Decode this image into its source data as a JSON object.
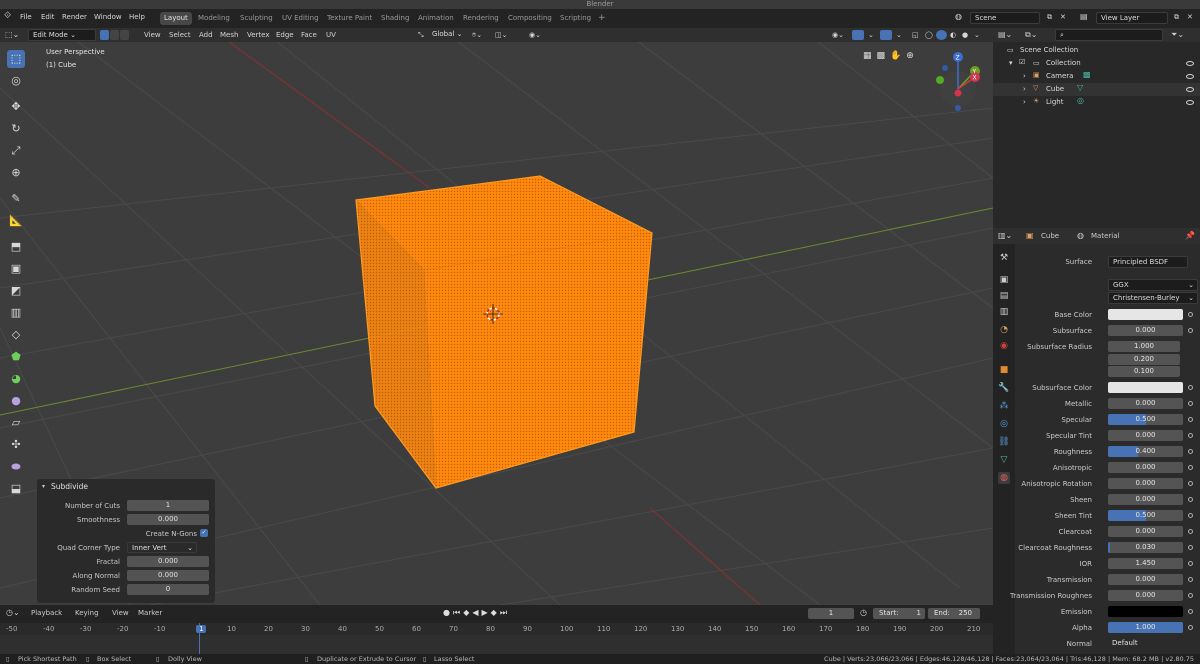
{
  "window": {
    "title": "Blender"
  },
  "menu": [
    "File",
    "Edit",
    "Render",
    "Window",
    "Help"
  ],
  "workspaces": [
    "Layout",
    "Modeling",
    "Sculpting",
    "UV Editing",
    "Texture Paint",
    "Shading",
    "Animation",
    "Rendering",
    "Compositing",
    "Scripting"
  ],
  "workspace_add": "+",
  "scene": {
    "name": "Scene"
  },
  "view_layer": {
    "name": "View Layer"
  },
  "viewport": {
    "mode": "Edit Mode",
    "menus": [
      "View",
      "Select",
      "Add",
      "Mesh",
      "Vertex",
      "Edge",
      "Face",
      "UV"
    ],
    "transform_orientation": "Global",
    "overlay_title": "User Perspective",
    "overlay_object": "(1) Cube",
    "gizmo": {
      "z": "Z",
      "y": "Y",
      "x": "X"
    }
  },
  "operator_panel": {
    "title": "Subdivide",
    "fields": [
      {
        "label": "Number of Cuts",
        "value": "1"
      },
      {
        "label": "Smoothness",
        "value": "0.000"
      },
      {
        "label": "Create N-Gons",
        "checked": true
      },
      {
        "label": "Quad Corner Type",
        "value": "Inner Vert"
      },
      {
        "label": "Fractal",
        "value": "0.000"
      },
      {
        "label": "Along Normal",
        "value": "0.000"
      },
      {
        "label": "Random Seed",
        "value": "0"
      }
    ]
  },
  "timeline": {
    "menus": [
      "Playback",
      "Keying",
      "View",
      "Marker"
    ],
    "current_frame": "1",
    "start_label": "Start:",
    "start": "1",
    "end_label": "End:",
    "end": "250",
    "ruler": [
      "-50",
      "-40",
      "-30",
      "-20",
      "-10",
      "1",
      "10",
      "20",
      "30",
      "40",
      "50",
      "60",
      "70",
      "80",
      "90",
      "100",
      "110",
      "120",
      "130",
      "140",
      "150",
      "160",
      "170",
      "180",
      "190",
      "200",
      "210"
    ]
  },
  "statusbar": {
    "items": [
      "Pick Shortest Path",
      "Box Select",
      "Dolly View",
      "Duplicate or Extrude to Cursor",
      "Lasso Select"
    ],
    "right": "Cube | Verts:23,066/23,066 | Edges:46,128/46,128 | Faces:23,064/23,064 | Tris:46,128 | Mem: 68.2 MB | v2.80.75"
  },
  "outliner": {
    "root": "Scene Collection",
    "collection": "Collection",
    "items": [
      "Camera",
      "Cube",
      "Light"
    ]
  },
  "properties": {
    "object": "Cube",
    "material": "Material",
    "surface_label": "Surface",
    "surface_value": "Principled BSDF",
    "distribution": "GGX",
    "subsurface_method": "Christensen-Burley",
    "rows": [
      {
        "label": "Base Color",
        "type": "color",
        "color": "#e6e6e6"
      },
      {
        "label": "Subsurface",
        "value": "0.000"
      },
      {
        "label": "Subsurface Radius",
        "values": [
          "1.000",
          "0.200",
          "0.100"
        ]
      },
      {
        "label": "Subsurface Color",
        "type": "color",
        "color": "#e6e6e6"
      },
      {
        "label": "Metallic",
        "value": "0.000"
      },
      {
        "label": "Specular",
        "value": "0.500",
        "fill": 0.5
      },
      {
        "label": "Specular Tint",
        "value": "0.000"
      },
      {
        "label": "Roughness",
        "value": "0.400",
        "fill": 0.4
      },
      {
        "label": "Anisotropic",
        "value": "0.000"
      },
      {
        "label": "Anisotropic Rotation",
        "value": "0.000"
      },
      {
        "label": "Sheen",
        "value": "0.000"
      },
      {
        "label": "Sheen Tint",
        "value": "0.500",
        "fill": 0.5
      },
      {
        "label": "Clearcoat",
        "value": "0.000"
      },
      {
        "label": "Clearcoat Roughness",
        "value": "0.030",
        "fill": 0.03
      },
      {
        "label": "IOR",
        "value": "1.450"
      },
      {
        "label": "Transmission",
        "value": "0.000"
      },
      {
        "label": "Transmission Roughnes",
        "value": "0.000"
      },
      {
        "label": "Emission",
        "type": "color",
        "color": "#000000"
      },
      {
        "label": "Alpha",
        "value": "1.000",
        "fill": 1.0
      },
      {
        "label": "Normal",
        "value": "Default",
        "plain": true
      }
    ]
  },
  "colors": {
    "accent": "#4772b3",
    "mesh": "#ff7a00",
    "mesh_dark": "#e56a00"
  }
}
